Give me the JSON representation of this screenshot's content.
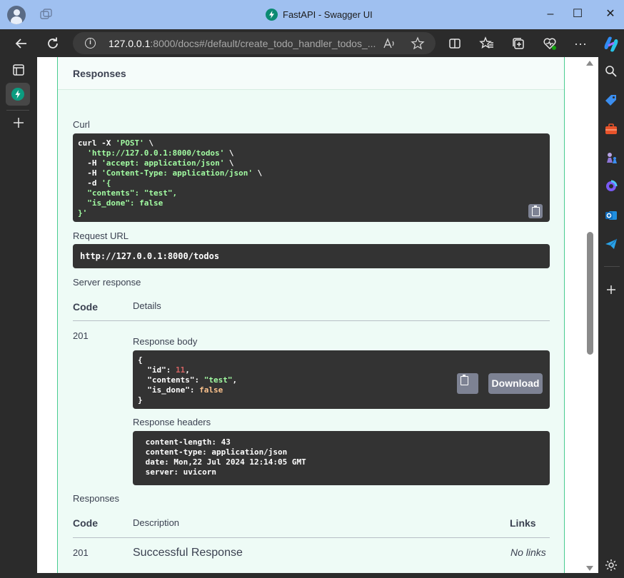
{
  "window": {
    "title": "FastAPI - Swagger UI",
    "controls": {
      "minimize": "–",
      "maximize": "☐",
      "close": "✕"
    }
  },
  "browser": {
    "url_host": "127.0.0.1",
    "url_rest": ":8000/docs#/default/create_todo_handler_todos_...",
    "read_aloud_icon": "A)",
    "more_icon": "···"
  },
  "page": {
    "responses_header": "Responses",
    "curl_label": "Curl",
    "curl_lines": [
      {
        "plain": "curl -X ",
        "str": "'POST'",
        "tail": " \\"
      },
      {
        "plain": "  ",
        "str": "'http://127.0.0.1:8000/todos'",
        "tail": " \\"
      },
      {
        "plain": "  -H ",
        "str": "'accept: application/json'",
        "tail": " \\"
      },
      {
        "plain": "  -H ",
        "str": "'Content-Type: application/json'",
        "tail": " \\"
      },
      {
        "plain": "  -d ",
        "str": "'{",
        "tail": ""
      },
      {
        "plain": "",
        "str": "  \"contents\": \"test\",",
        "tail": ""
      },
      {
        "plain": "",
        "str": "  \"is_done\": false",
        "tail": ""
      },
      {
        "plain": "",
        "str": "}'",
        "tail": ""
      }
    ],
    "request_url_label": "Request URL",
    "request_url": "http://127.0.0.1:8000/todos",
    "server_response_label": "Server response",
    "col_code": "Code",
    "col_details": "Details",
    "status_code": "201",
    "response_body_label": "Response body",
    "body_lines": {
      "open": "{",
      "id_key": "  \"id\": ",
      "id_val": "11",
      "contents_key": "  \"contents\": ",
      "contents_val": "\"test\"",
      "is_done_key": "  \"is_done\": ",
      "is_done_val": "false",
      "close": "}"
    },
    "download_label": "Download",
    "response_headers_label": "Response headers",
    "headers_lines": [
      " content-length: 43 ",
      " content-type: application/json ",
      " date: Mon,22 Jul 2024 12:14:05 GMT ",
      " server: uvicorn "
    ],
    "responses_label": "Responses",
    "col_description": "Description",
    "col_links": "Links",
    "resp_code": "201",
    "resp_description": "Successful Response",
    "resp_links": "No links"
  },
  "colors": {
    "accent": "#49cc90",
    "code_bg": "#333333",
    "string_green": "#a2fca2"
  }
}
